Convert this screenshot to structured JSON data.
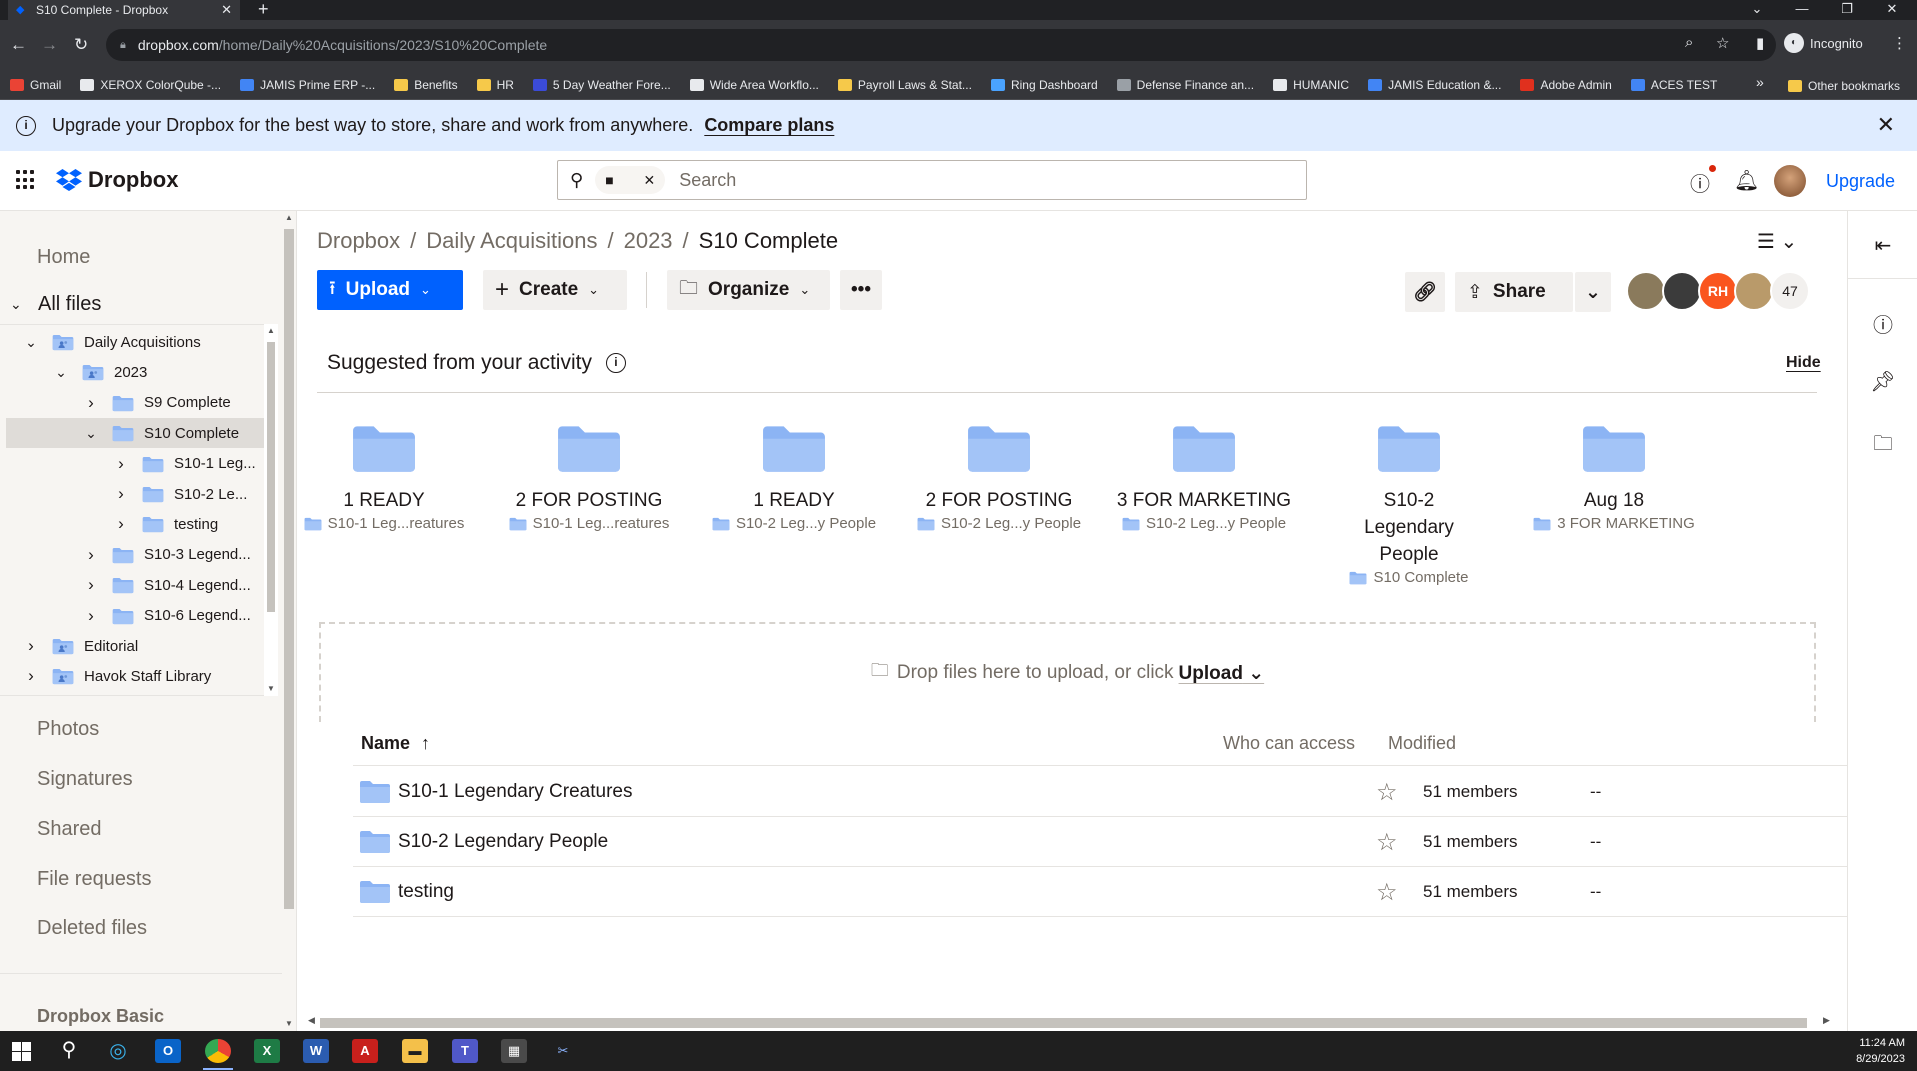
{
  "browser": {
    "tab_title": "S10 Complete - Dropbox",
    "tab_icon": "dropbox-favicon-icon",
    "url_host": "dropbox.com",
    "url_path": "/home/Daily%20Acquisitions/2023/S10%20Complete",
    "profile_label": "Incognito",
    "bookmarks": [
      {
        "label": "Gmail",
        "color": "#ea4335"
      },
      {
        "label": "XEROX ColorQube -...",
        "color": "#e8eaed"
      },
      {
        "label": "JAMIS Prime ERP -...",
        "color": "#4285f4"
      },
      {
        "label": "Benefits",
        "color": "#f6c94a"
      },
      {
        "label": "HR",
        "color": "#f6c94a"
      },
      {
        "label": "5 Day Weather Fore...",
        "color": "#3b4bd9"
      },
      {
        "label": "Wide Area Workflo...",
        "color": "#e8eaed"
      },
      {
        "label": "Payroll Laws & Stat...",
        "color": "#f6c94a"
      },
      {
        "label": "Ring Dashboard",
        "color": "#4aa3ff"
      },
      {
        "label": "Defense Finance an...",
        "color": "#9aa0a6"
      },
      {
        "label": "HUMANIC",
        "color": "#e8eaed"
      },
      {
        "label": "JAMIS Education &...",
        "color": "#4285f4"
      },
      {
        "label": "Adobe Admin",
        "color": "#e0301e"
      },
      {
        "label": "ACES TEST",
        "color": "#4285f4"
      }
    ],
    "bookmarks_more": "»",
    "other_bookmarks": "Other bookmarks"
  },
  "banner": {
    "message": "Upgrade your Dropbox for the best way to store, share and work from anywhere.",
    "cta": "Compare plans"
  },
  "header": {
    "logo_text": "Dropbox",
    "search_placeholder": "Search",
    "upgrade_label": "Upgrade"
  },
  "sidebar": {
    "home": "Home",
    "all_files": "All files",
    "tree": [
      {
        "label": "Daily Acquisitions",
        "level": 0,
        "expanded": true,
        "shared": true
      },
      {
        "label": "2023",
        "level": 1,
        "expanded": true,
        "shared": true
      },
      {
        "label": "S9 Complete",
        "level": 2,
        "expanded": false,
        "shared": false
      },
      {
        "label": "S10 Complete",
        "level": 2,
        "expanded": true,
        "shared": false,
        "selected": true
      },
      {
        "label": "S10-1 Leg...",
        "level": 3,
        "expanded": false,
        "shared": false
      },
      {
        "label": "S10-2 Le...",
        "level": 3,
        "expanded": false,
        "shared": false
      },
      {
        "label": "testing",
        "level": 3,
        "expanded": false,
        "shared": false
      },
      {
        "label": "S10-3 Legend...",
        "level": 2,
        "expanded": false,
        "shared": false
      },
      {
        "label": "S10-4 Legend...",
        "level": 2,
        "expanded": false,
        "shared": false
      },
      {
        "label": "S10-6 Legend...",
        "level": 2,
        "expanded": false,
        "shared": false
      },
      {
        "label": "Editorial",
        "level": 0,
        "expanded": false,
        "shared": true
      },
      {
        "label": "Havok Staff Library",
        "level": 0,
        "expanded": false,
        "shared": true
      }
    ],
    "nav": [
      "Photos",
      "Signatures",
      "Shared",
      "File requests",
      "Deleted files"
    ],
    "plan": "Dropbox Basic"
  },
  "main": {
    "breadcrumb": [
      "Dropbox",
      "Daily Acquisitions",
      "2023",
      "S10 Complete"
    ],
    "breadcrumb_sep": "/",
    "upload_label": "Upload",
    "create_label": "Create",
    "organize_label": "Organize",
    "share_label": "Share",
    "avatars": [
      {
        "initials": "",
        "color": "#8a7a5c"
      },
      {
        "initials": "",
        "color": "#3b3b3b"
      },
      {
        "initials": "RH",
        "color": "#fa551e"
      },
      {
        "initials": "",
        "color": "#b99a6a"
      }
    ],
    "member_count": "47",
    "suggested": {
      "title": "Suggested from your activity",
      "hide_label": "Hide",
      "items": [
        {
          "name": "1 READY",
          "location": "S10-1 Leg...reatures"
        },
        {
          "name": "2 FOR POSTING",
          "location": "S10-1 Leg...reatures"
        },
        {
          "name": "1 READY",
          "location": "S10-2 Leg...y People"
        },
        {
          "name": "2 FOR POSTING",
          "location": "S10-2 Leg...y People"
        },
        {
          "name": "3 FOR MARKETING",
          "location": "S10-2 Leg...y People"
        },
        {
          "name": "S10-2 Legendary People",
          "location": "S10 Complete"
        },
        {
          "name": "Aug 18",
          "location": "3 FOR MARKETING"
        }
      ]
    },
    "dropzone": {
      "text": "Drop files here to upload, or click",
      "link": "Upload"
    },
    "table": {
      "columns": [
        "Name",
        "Who can access",
        "Modified"
      ],
      "sort_indicator": "↑",
      "rows": [
        {
          "name": "S10-1 Legendary Creatures",
          "access": "51 members",
          "modified": "--"
        },
        {
          "name": "S10-2 Legendary People",
          "access": "51 members",
          "modified": "--"
        },
        {
          "name": "testing",
          "access": "51 members",
          "modified": "--"
        }
      ]
    }
  },
  "taskbar": {
    "time": "11:24 AM",
    "date": "8/29/2023"
  },
  "colors": {
    "accent": "#0061fe",
    "folder": "#a3c4f7",
    "folder_dark": "#8cb4f4",
    "text": "#1e1919",
    "muted": "#736c64"
  }
}
